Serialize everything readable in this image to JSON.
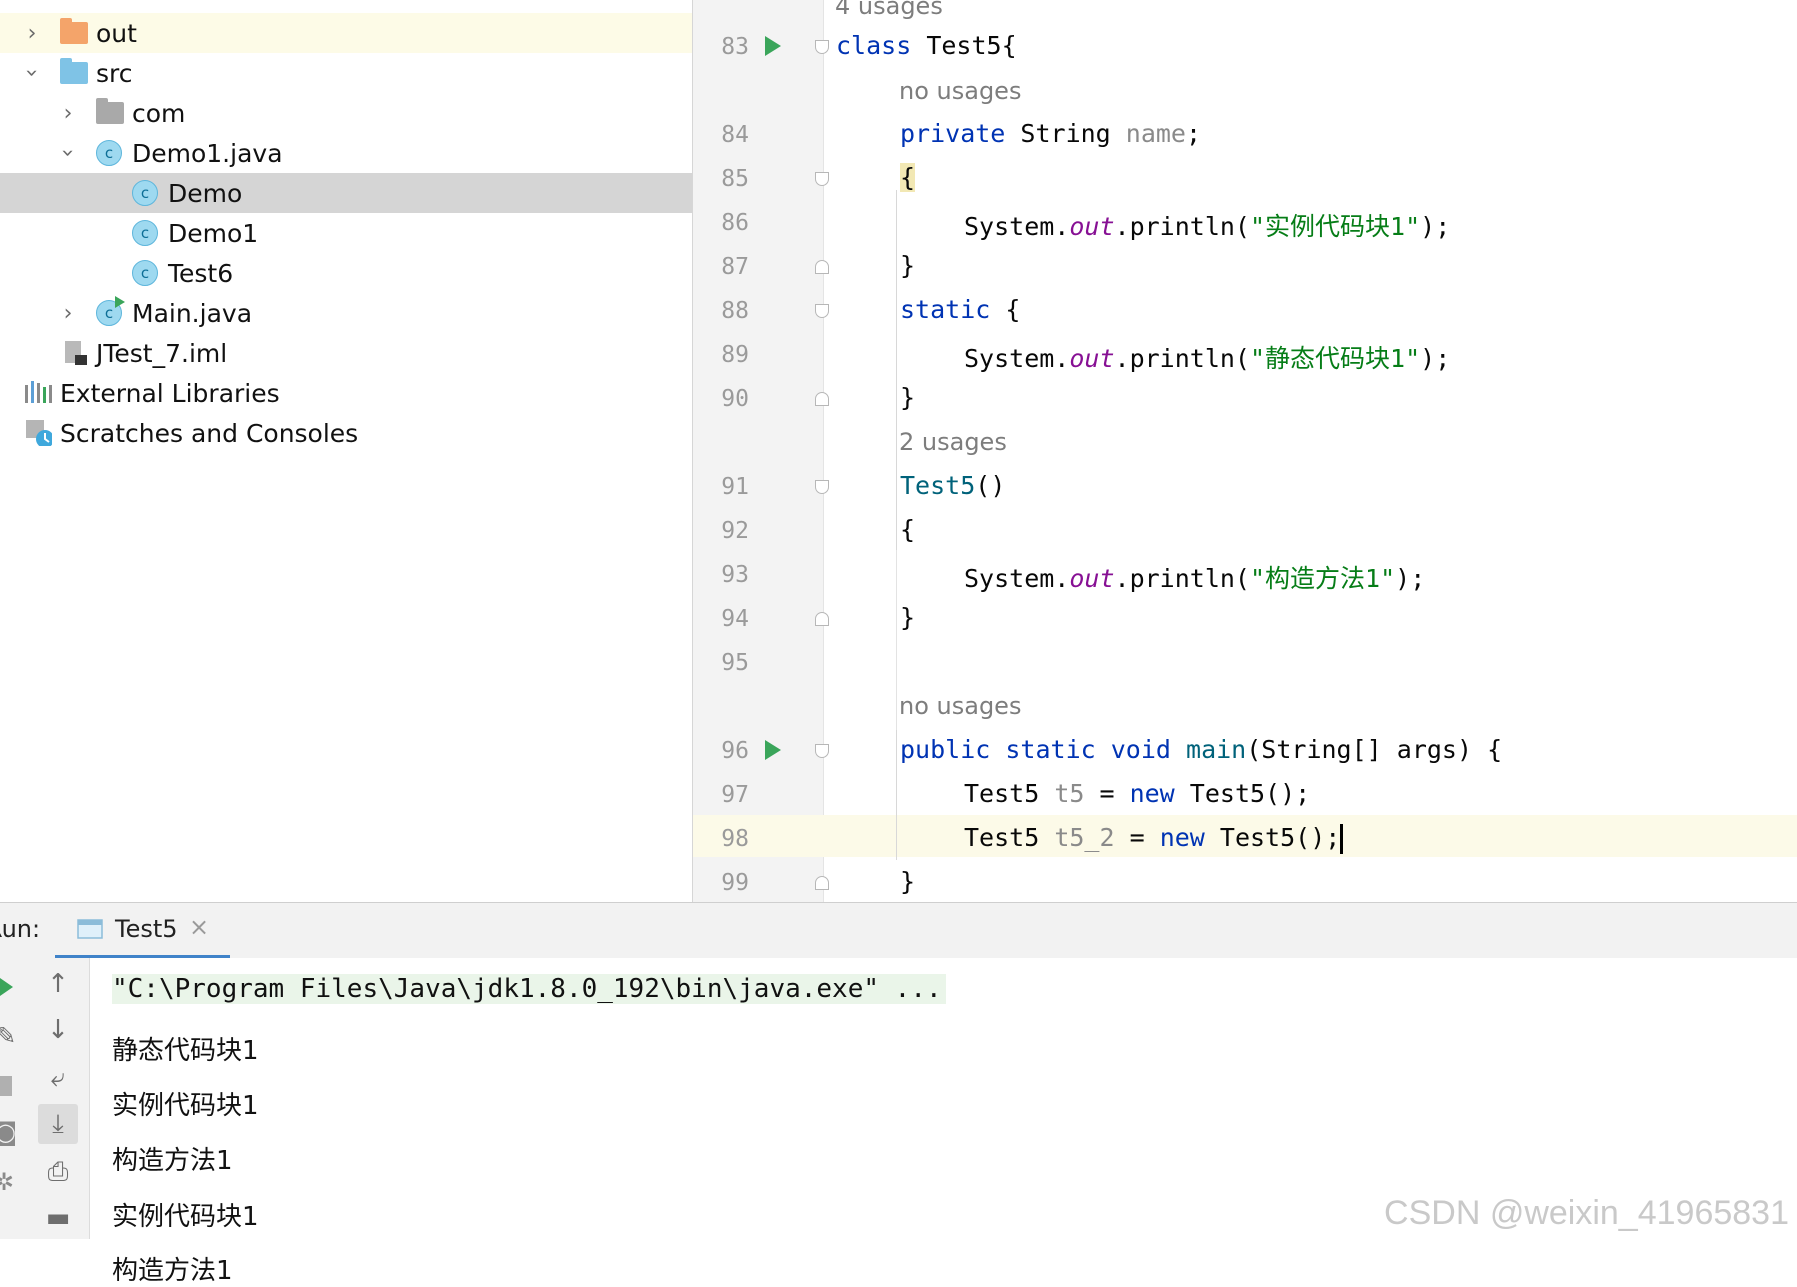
{
  "project_tree": {
    "items": [
      {
        "label": "out",
        "icon": "folder-orange-icon",
        "expanded": false,
        "highlighted": true
      },
      {
        "label": "src",
        "icon": "folder-blue-icon",
        "expanded": true
      },
      {
        "label": "com",
        "icon": "package-folder-icon",
        "expanded": false
      },
      {
        "label": "Demo1.java",
        "icon": "java-class-icon",
        "expanded": true
      },
      {
        "label": "Demo",
        "icon": "java-class-icon",
        "selected": true
      },
      {
        "label": "Demo1",
        "icon": "java-class-icon"
      },
      {
        "label": "Test6",
        "icon": "java-class-icon"
      },
      {
        "label": "Main.java",
        "icon": "java-class-runnable-icon",
        "expanded": false
      },
      {
        "label": "JTest_7.iml",
        "icon": "module-file-icon"
      },
      {
        "label": "External Libraries",
        "icon": "libraries-icon"
      },
      {
        "label": "Scratches and Consoles",
        "icon": "scratches-icon"
      }
    ]
  },
  "editor": {
    "hints": {
      "h4": "4 usages",
      "none1": "no usages",
      "h2": "2 usages",
      "none2": "no usages"
    },
    "line_numbers": [
      "83",
      "84",
      "85",
      "86",
      "87",
      "88",
      "89",
      "90",
      "91",
      "92",
      "93",
      "94",
      "95",
      "96",
      "97",
      "98",
      "99"
    ],
    "code": {
      "l83": [
        "class",
        " Test5{"
      ],
      "l84": [
        "private",
        " String ",
        "name",
        ";"
      ],
      "l85": "{",
      "l86": [
        "System.",
        "out",
        ".println(",
        "\"实例代码块1\"",
        ");"
      ],
      "l87": "}",
      "l88": [
        "static",
        " {"
      ],
      "l89": [
        "System.",
        "out",
        ".println(",
        "\"静态代码块1\"",
        ");"
      ],
      "l90": "}",
      "l91": [
        "Test5",
        "()"
      ],
      "l92": "{",
      "l93": [
        "System.",
        "out",
        ".println(",
        "\"构造方法1\"",
        ");"
      ],
      "l94": "}",
      "l96": [
        "public",
        " ",
        "static",
        " ",
        "void",
        " ",
        "main",
        "(String[] args) {"
      ],
      "l97": [
        "Test5 ",
        "t5",
        " = ",
        "new",
        " Test5();"
      ],
      "l98": [
        "Test5 ",
        "t5_2",
        " = ",
        "new",
        " Test5();"
      ],
      "l99": "}"
    },
    "current_line": "98"
  },
  "run_panel": {
    "label": "Run:",
    "tab": "Test5",
    "output": [
      "\"C:\\Program Files\\Java\\jdk1.8.0_192\\bin\\java.exe\" ...",
      "静态代码块1",
      "实例代码块1",
      "构造方法1",
      "实例代码块1",
      "构造方法1"
    ]
  },
  "watermark": "CSDN @weixin_41965831",
  "colors": {
    "keyword": "#0033b3",
    "string": "#067d17",
    "field_static": "#871094",
    "run_green": "#3aa55a",
    "selection": "#d5d5d5"
  }
}
